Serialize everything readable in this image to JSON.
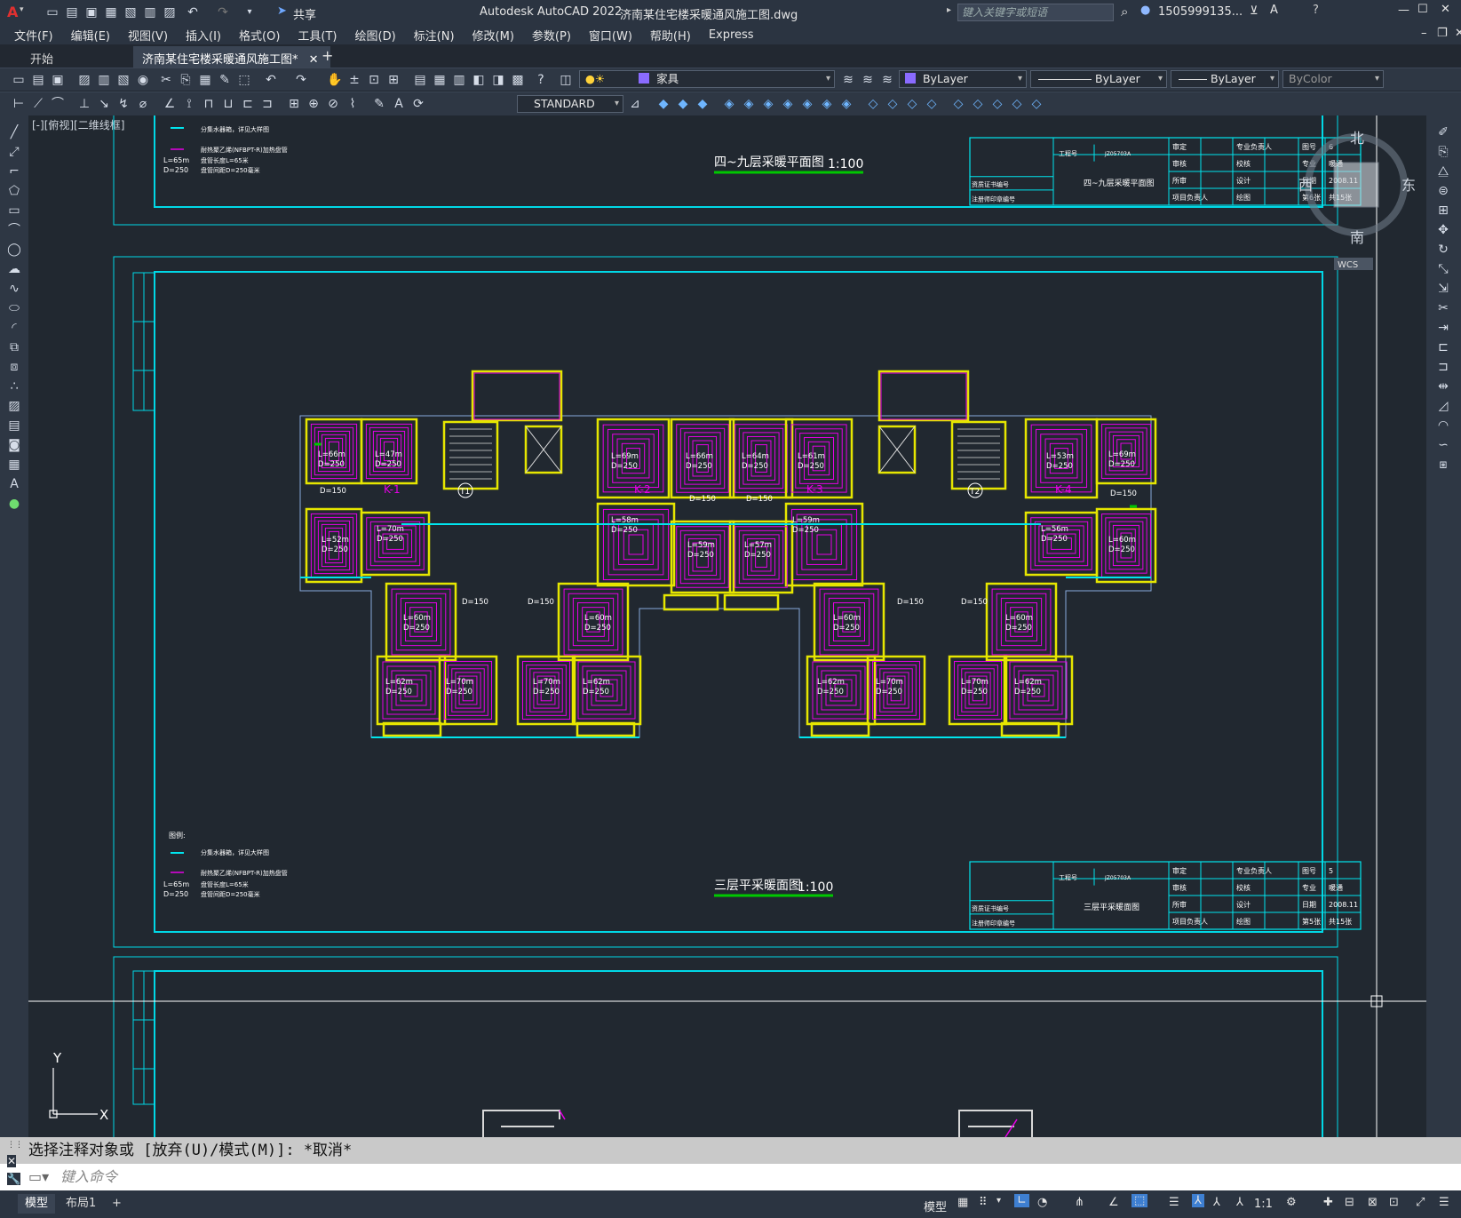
{
  "app": {
    "title": "Autodesk AutoCAD 2022",
    "document": "济南某住宅楼采暖通风施工图.dwg",
    "share": "共享",
    "search_placeholder": "键入关键字或短语",
    "user": "1505999135...",
    "logo": "A"
  },
  "menu": [
    "文件(F)",
    "编辑(E)",
    "视图(V)",
    "插入(I)",
    "格式(O)",
    "工具(T)",
    "绘图(D)",
    "标注(N)",
    "修改(M)",
    "参数(P)",
    "窗口(W)",
    "帮助(H)",
    "Express"
  ],
  "tabs": {
    "start": "开始",
    "active": "济南某住宅楼采暖通风施工图*",
    "close": "✕",
    "add": "+"
  },
  "toolbar": {
    "layer": "家具",
    "color": "ByLayer",
    "linetype": "ByLayer",
    "lineweight": "ByLayer",
    "plotstyle": "ByColor",
    "textstyle": "STANDARD"
  },
  "viewport": {
    "label": "[-][俯视][二维线框]"
  },
  "viewcube": {
    "n": "北",
    "s": "南",
    "w": "西",
    "e": "东",
    "wcs": "WCS"
  },
  "drawing": {
    "sheet_top_title": "四~九层采暖平面图",
    "sheet_top_scale": "1:100",
    "sheet_main_title": "三层平采暖面图",
    "sheet_main_scale": "1:100",
    "legend_head": "图例:",
    "legend_1": "分集水器箱，详见大样图",
    "legend_2": "耐热聚乙烯(NFBPT-R)加热盘管",
    "legend_3a": "L=65m",
    "legend_3b": "盘管长度L=65米",
    "legend_4a": "D=250",
    "legend_4b": "盘管间距D=250毫米",
    "room_labels": [
      {
        "l": "L=66m",
        "d": "D=250"
      },
      {
        "l": "L=47m",
        "d": "D=250"
      },
      {
        "l": "L=69m",
        "d": "D=250"
      },
      {
        "l": "L=66m",
        "d": "D=250"
      },
      {
        "l": "L=64m",
        "d": "D=250"
      },
      {
        "l": "L=61m",
        "d": "D=250"
      },
      {
        "l": "L=53m",
        "d": "D=250"
      },
      {
        "l": "L=69m",
        "d": "D=250"
      },
      {
        "l": "L=52m",
        "d": "D=250"
      },
      {
        "l": "L=70m",
        "d": "D=250"
      },
      {
        "l": "L=58m",
        "d": "D=250"
      },
      {
        "l": "L=59m",
        "d": "D=250"
      },
      {
        "l": "L=56m",
        "d": "D=250"
      },
      {
        "l": "L=60m",
        "d": "D=250"
      },
      {
        "l": "L=59m",
        "d": "D=250"
      },
      {
        "l": "L=57m",
        "d": "D=250"
      },
      {
        "l": "L=60m",
        "d": "D=250"
      },
      {
        "l": "L=60m",
        "d": "D=250"
      },
      {
        "l": "L=60m",
        "d": "D=250"
      },
      {
        "l": "L=60m",
        "d": "D=250"
      },
      {
        "l": "L=62m",
        "d": "D=250"
      },
      {
        "l": "L=70m",
        "d": "D=250"
      },
      {
        "l": "L=70m",
        "d": "D=250"
      },
      {
        "l": "L=62m",
        "d": "D=250"
      },
      {
        "l": "L=62m",
        "d": "D=250"
      },
      {
        "l": "L=70m",
        "d": "D=250"
      },
      {
        "l": "L=70m",
        "d": "D=250"
      },
      {
        "l": "L=62m",
        "d": "D=250"
      }
    ],
    "d150": "D=150",
    "unit_marks": [
      "K-1",
      "K-2",
      "K-3",
      "K-4"
    ],
    "axis_marks": [
      "T1",
      "T2"
    ],
    "title_block_top": {
      "r1": [
        "审定",
        "专业负责人",
        "图号",
        "6"
      ],
      "r2": [
        "审核",
        "校核",
        "专业",
        "暖通"
      ],
      "r3": [
        "所审",
        "设计",
        "日期",
        "2008.11"
      ],
      "r4": [
        "项目负责人",
        "绘图",
        "第6张",
        "共15张"
      ],
      "job": "工程号",
      "jobno": "JZ05703A",
      "name": "四~九层采暖平面图",
      "left1": "资质证书编号",
      "left2": "注册师印章编号"
    },
    "title_block_main": {
      "r1": [
        "审定",
        "专业负责人",
        "图号",
        "5"
      ],
      "r2": [
        "审核",
        "校核",
        "专业",
        "暖通"
      ],
      "r3": [
        "所审",
        "设计",
        "日期",
        "2008.11"
      ],
      "r4": [
        "项目负责人",
        "绘图",
        "第5张",
        "共15张"
      ],
      "job": "工程号",
      "jobno": "JZ05703A",
      "name": "三层平采暖面图",
      "left1": "资质证书编号",
      "left2": "注册师印章编号"
    },
    "ucs_x": "X",
    "ucs_y": "Y"
  },
  "command": {
    "history": "选择注释对象或 [放弃(U)/模式(M)]: *取消*",
    "placeholder": "键入命令"
  },
  "status": {
    "model": "模型",
    "layout1": "布局1",
    "add": "+",
    "model_btn": "模型",
    "scale": "1:1"
  },
  "colors": {
    "magenta": "#e600e6",
    "cyan": "#00e5ee",
    "yellow": "#e6e600",
    "green": "#00c800",
    "bg": "#212830"
  }
}
